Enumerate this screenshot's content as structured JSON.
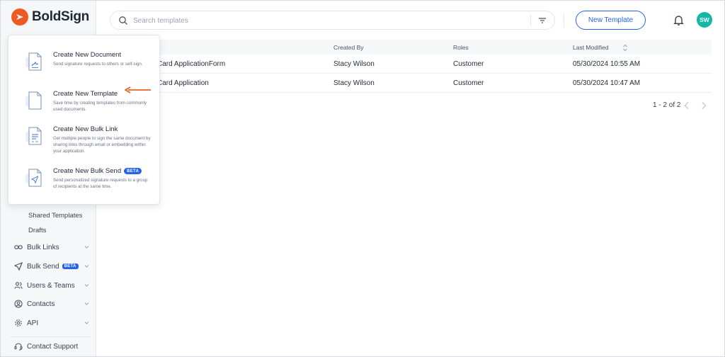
{
  "brand": {
    "name": "BoldSign",
    "accent": "#ef5a23"
  },
  "search": {
    "placeholder": "Search templates"
  },
  "header": {
    "new_template_label": "New Template",
    "avatar_initials": "SW",
    "primary_color": "#2563eb",
    "avatar_color": "#14b8a6"
  },
  "menu": {
    "items": [
      {
        "title": "Create New Document",
        "description": "Send signature requests to others or self-sign.",
        "icon": "document-sign-icon"
      },
      {
        "title": "Create New Template",
        "description": "Save time by creating templates from commonly used documents.",
        "icon": "template-icon"
      },
      {
        "title": "Create New Bulk Link",
        "description": "Get multiple people to sign the same document by sharing links through email or embedding within your application.",
        "icon": "bulk-link-icon"
      },
      {
        "title": "Create New Bulk Send",
        "badge": "BETA",
        "description": "Send personalized signature requests to a group of recipients at the same time.",
        "icon": "bulk-send-icon"
      }
    ]
  },
  "sidebar": {
    "subitems": [
      "Shared Templates",
      "Drafts"
    ],
    "items": [
      {
        "label": "Bulk Links",
        "icon": "link-icon"
      },
      {
        "label": "Bulk Send",
        "badge": "BETA",
        "icon": "send-icon"
      },
      {
        "label": "Users & Teams",
        "icon": "users-icon"
      },
      {
        "label": "Contacts",
        "icon": "contact-icon"
      },
      {
        "label": "API",
        "icon": "gear-icon"
      },
      {
        "label": "Contact Support",
        "icon": "headset-icon"
      }
    ]
  },
  "table": {
    "columns": [
      "Created By",
      "Roles",
      "Last Modified"
    ],
    "rows": [
      {
        "name": "Card ApplicationForm",
        "created_by": "Stacy Wilson",
        "role": "Customer",
        "modified": "05/30/2024 10:55 AM"
      },
      {
        "name": "Card Application",
        "created_by": "Stacy Wilson",
        "role": "Customer",
        "modified": "05/30/2024 10:47 AM"
      }
    ],
    "pagination": "1 - 2 of 2"
  }
}
